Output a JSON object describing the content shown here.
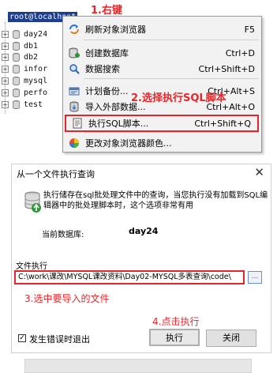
{
  "tree": {
    "root_label": "root@localhost",
    "items": [
      {
        "label": "day24"
      },
      {
        "label": "db1"
      },
      {
        "label": "db2"
      },
      {
        "label": "infor"
      },
      {
        "label": "mysql"
      },
      {
        "label": "perfo"
      },
      {
        "label": "test"
      }
    ]
  },
  "context_menu": {
    "items": [
      {
        "label": "刷新对象浏览器",
        "shortcut": "F5",
        "icon": "refresh-icon"
      },
      {
        "label": "创建数据库",
        "shortcut": "Ctrl+D",
        "icon": "create-db-icon"
      },
      {
        "label": "数据搜索",
        "shortcut": "Ctrl+Shift+D",
        "icon": "search-icon"
      },
      {
        "label": "计划备份...",
        "shortcut": "Ctrl+Alt+S",
        "icon": "backup-icon"
      },
      {
        "label": "导入外部数据...",
        "shortcut": "Ctrl+Alt+O",
        "icon": "import-icon"
      },
      {
        "label": "执行SQL脚本...",
        "shortcut": "Ctrl+Shift+Q",
        "icon": "sql-script-icon"
      },
      {
        "label": "更改对象浏览器颜色...",
        "shortcut": "",
        "icon": "color-wheel-icon"
      }
    ]
  },
  "annotations": {
    "step1": "1.右键",
    "step2": "2.选择执行SQL脚本",
    "step3": "3.选中要导入的文件",
    "step4": "4.点击执行"
  },
  "dialog": {
    "title": "从一个文件执行查询",
    "close_glyph": "✕",
    "description": "执行储存在sql批处理文件中的查询，当您执行没有加载到SQL编辑器中的批处理脚本时，这个选项非常有用",
    "current_db_label": "当前数据库:",
    "current_db_value": "day24",
    "file_label": "文件执行",
    "file_path": "C:\\work\\课改\\MYSQL课改资料\\Day02-MYSQL多表查询\\code\\",
    "browse_label": "...",
    "exit_on_error_label": "发生错误时退出",
    "exit_on_error_checked": true,
    "execute_label": "执行",
    "close_label": "关闭"
  }
}
